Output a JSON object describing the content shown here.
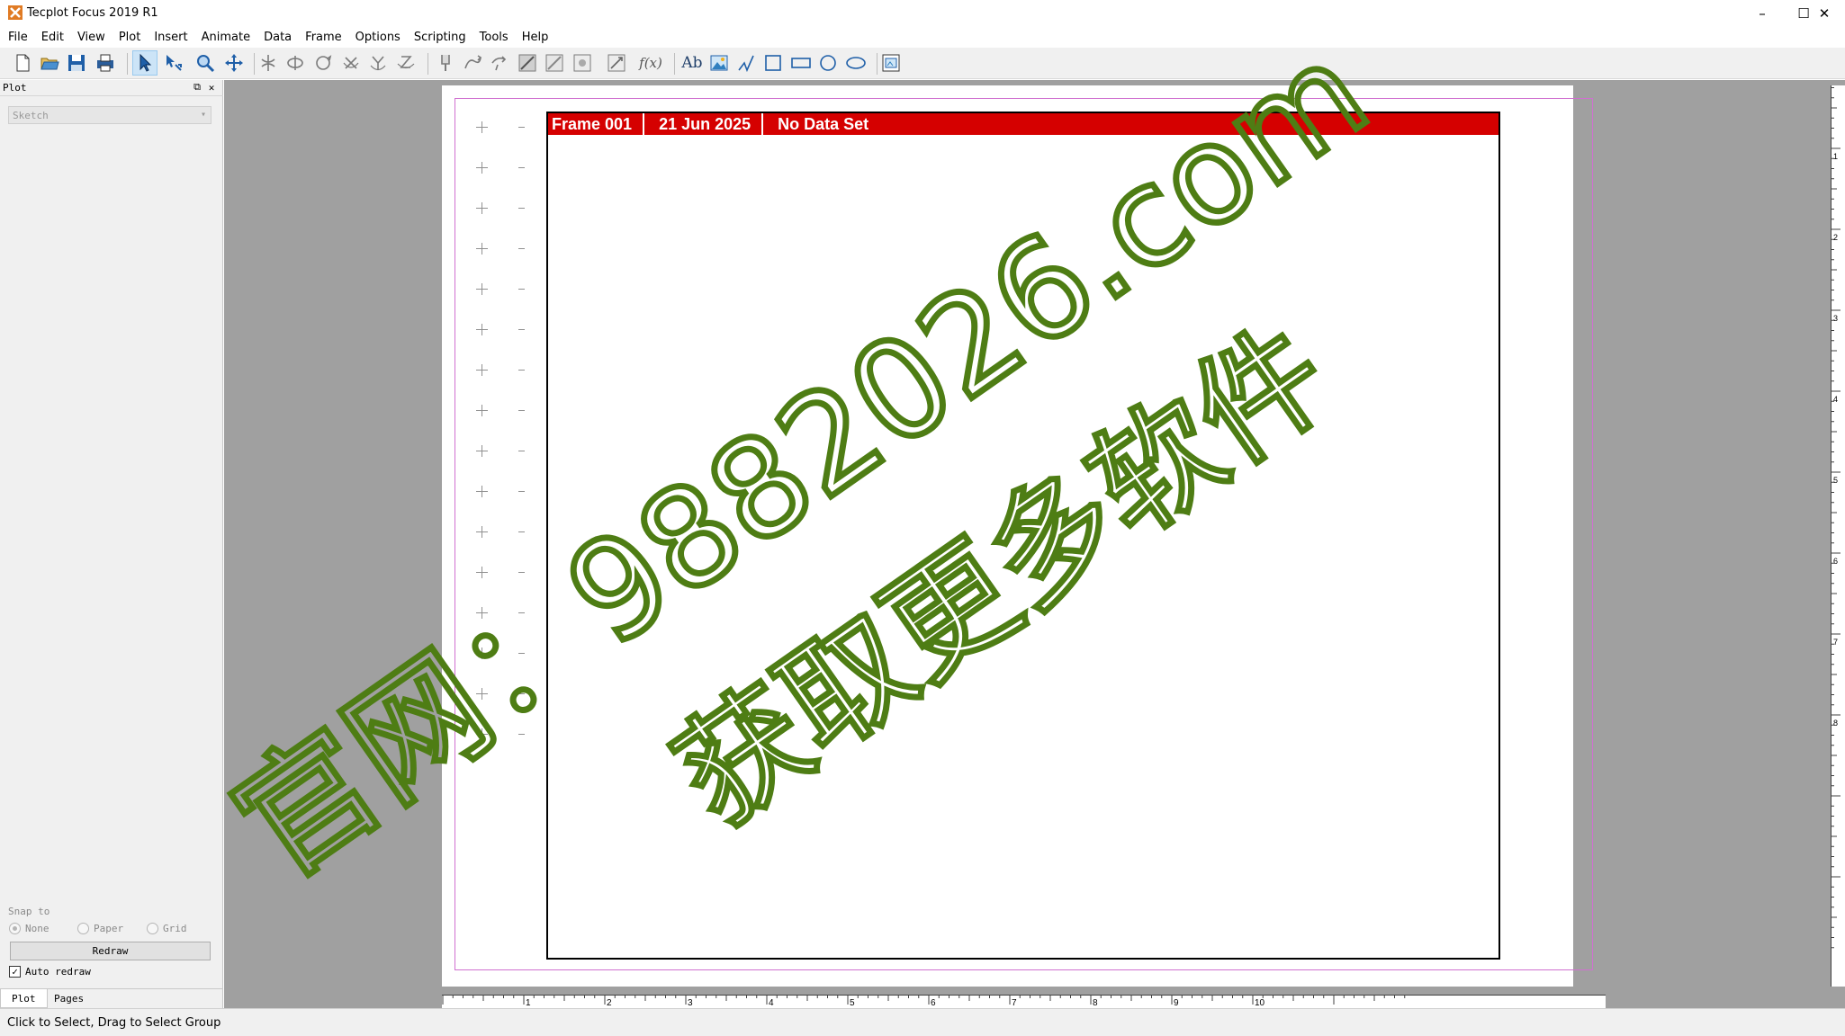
{
  "window": {
    "title": "Tecplot Focus 2019 R1",
    "minimize_glyph": "–",
    "maximize_glyph": "☐",
    "close_glyph": "✕"
  },
  "menu": [
    "File",
    "Edit",
    "View",
    "Plot",
    "Insert",
    "Animate",
    "Data",
    "Frame",
    "Options",
    "Scripting",
    "Tools",
    "Help"
  ],
  "toolbar": {
    "buttons": [
      {
        "name": "new-layout-icon"
      },
      {
        "name": "open-layout-icon"
      },
      {
        "name": "save-layout-icon"
      },
      {
        "name": "print-icon"
      },
      {
        "name": "selector-arrow-icon"
      },
      {
        "name": "adjustor-icon"
      },
      {
        "name": "zoom-icon"
      },
      {
        "name": "translate-icon"
      },
      {
        "name": "spherical-rotate-icon"
      },
      {
        "name": "roller-ball-rotate-icon"
      },
      {
        "name": "twist-rotate-icon"
      },
      {
        "name": "x-rotate-icon"
      },
      {
        "name": "y-rotate-icon"
      },
      {
        "name": "z-rotate-icon"
      },
      {
        "name": "probe-icon"
      },
      {
        "name": "streamtrace-icon"
      },
      {
        "name": "streamtrace-rake-icon"
      },
      {
        "name": "contour-add-icon"
      },
      {
        "name": "contour-remove-icon"
      },
      {
        "name": "slice-icon"
      },
      {
        "name": "zone-edit-icon"
      },
      {
        "name": "function-icon"
      },
      {
        "name": "add-text-icon"
      },
      {
        "name": "add-image-icon"
      },
      {
        "name": "polyline-icon"
      },
      {
        "name": "square-icon"
      },
      {
        "name": "rectangle-icon"
      },
      {
        "name": "circle-icon"
      },
      {
        "name": "ellipse-icon"
      },
      {
        "name": "create-frame-icon"
      }
    ],
    "function_glyph": "f(x)",
    "text_glyph": "Ab"
  },
  "sidebar": {
    "title": "Plot",
    "float_glyph": "⧉",
    "close_glyph": "✕",
    "plot_type": "Sketch",
    "snap_to_label": "Snap to",
    "snap_options": [
      {
        "label": "None",
        "selected": true
      },
      {
        "label": "Paper",
        "selected": false
      },
      {
        "label": "Grid",
        "selected": false
      }
    ],
    "redraw_label": "Redraw",
    "auto_redraw_label": "Auto redraw",
    "auto_redraw_checked": true,
    "check_glyph": "✓",
    "tabs": [
      {
        "label": "Plot",
        "active": true
      },
      {
        "label": "Pages",
        "active": false
      }
    ]
  },
  "frame": {
    "name": "Frame 001",
    "date": "21 Jun 2025",
    "dataset": "No Data Set",
    "header_color": "#d50000"
  },
  "rulers": {
    "horizontal_labels": [
      "1",
      "2",
      "3",
      "4",
      "5",
      "6",
      "7",
      "8",
      "9",
      "10"
    ],
    "vertical_labels": [
      "1",
      "2",
      "3",
      "4",
      "5",
      "6",
      "7",
      "8"
    ]
  },
  "watermark": {
    "line1": "官网：9882026.com",
    "line2": "获取更多软件",
    "color": "#4e7d14"
  },
  "status": {
    "text": "Click to Select, Drag to Select Group"
  }
}
